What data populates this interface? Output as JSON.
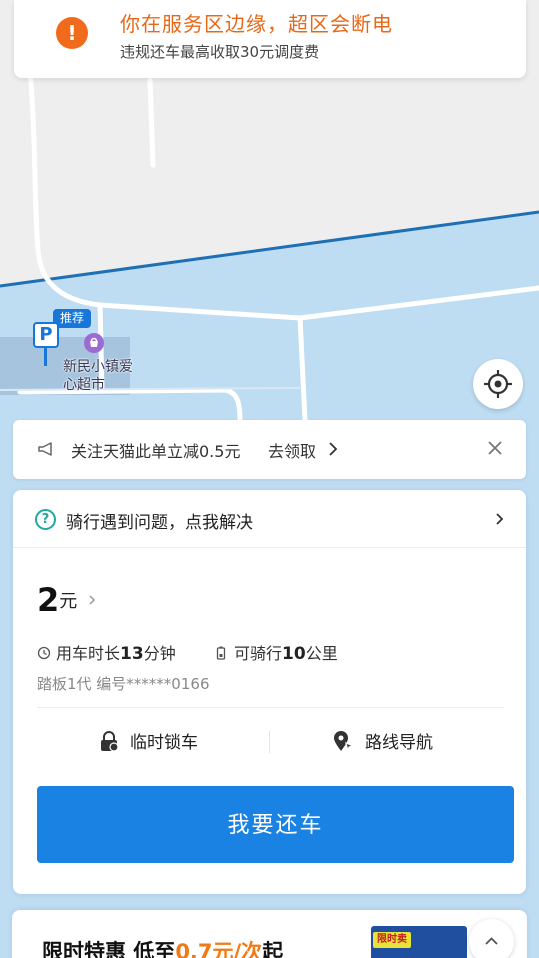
{
  "warning": {
    "icon": "exclamation-icon",
    "icon_text": "!",
    "title": "你在服务区边缘，超区会断电",
    "subtitle": "违规还车最高收取30元调度费"
  },
  "map": {
    "poi_badge": "推荐",
    "poi_parking": "P",
    "poi_name": "新民小镇爱心超市"
  },
  "promo": {
    "text": "关注天猫此单立减0.5元",
    "link": "去领取"
  },
  "help": {
    "text": "骑行遇到问题，点我解决"
  },
  "ride": {
    "price_value": "2",
    "price_unit": "元",
    "duration_label": "用车时长",
    "duration_value": "13",
    "duration_unit": "分钟",
    "range_label": "可骑行",
    "range_value": "10",
    "range_unit": "公里",
    "bike_info": "踏板1代 编号******0166"
  },
  "actions": {
    "lock_label": "临时锁车",
    "nav_label": "路线导航",
    "return_label": "我要还车"
  },
  "deal": {
    "prefix": "限时特惠 低至",
    "price": "0.7元/次",
    "suffix": "起",
    "tag": "限时卖"
  },
  "colors": {
    "warning": "#f26a1b",
    "primary": "#1a82e3",
    "help": "#23a99c",
    "service_area": "#bedcf2",
    "boundary": "#1f6fb5"
  }
}
